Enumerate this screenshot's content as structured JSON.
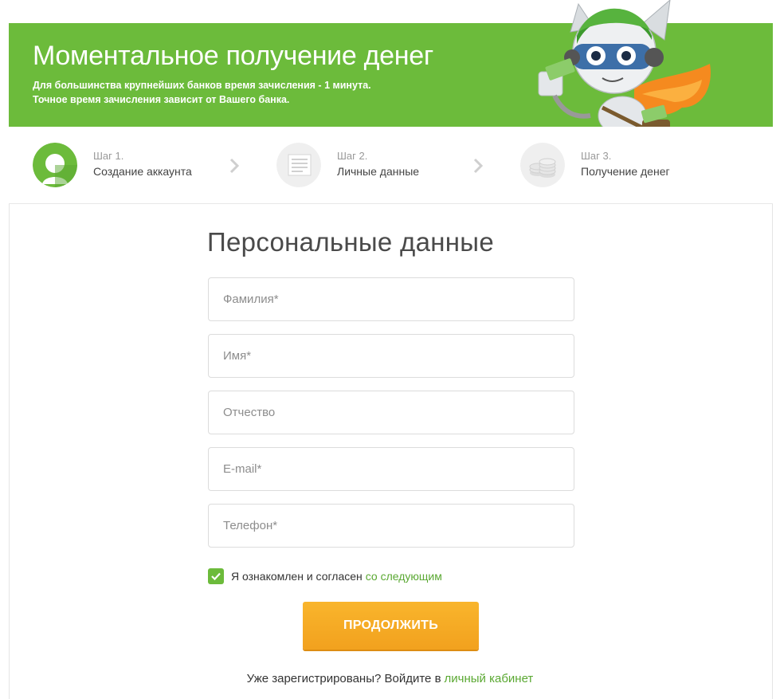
{
  "banner": {
    "title": "Моментальное получение денег",
    "subtitle_line1": "Для большинства крупнейших банков время зачисления - 1 минута.",
    "subtitle_line2": "Точное время зачисления зависит от Вашего банка.",
    "mascot": "robot-mascot",
    "bg_color": "#6cbb3b"
  },
  "steps": [
    {
      "num": "Шаг 1.",
      "label": "Создание аккаунта",
      "icon": "user-icon",
      "active": true
    },
    {
      "num": "Шаг 2.",
      "label": "Личные данные",
      "icon": "document-icon",
      "active": false
    },
    {
      "num": "Шаг 3.",
      "label": "Получение денег",
      "icon": "coins-icon",
      "active": false
    }
  ],
  "form": {
    "title": "Персональные данные",
    "fields": {
      "lastname": {
        "placeholder": "Фамилия*",
        "value": ""
      },
      "firstname": {
        "placeholder": "Имя*",
        "value": ""
      },
      "patronymic": {
        "placeholder": "Отчество",
        "value": ""
      },
      "email": {
        "placeholder": "E-mail*",
        "value": ""
      },
      "phone": {
        "placeholder": "Телефон*",
        "value": ""
      }
    },
    "agree_text": "Я ознакомлен и согласен",
    "agree_link": "со следующим",
    "agree_checked": true,
    "submit_label": "ПРОДОЛЖИТЬ",
    "login_text": "Уже зарегистрированы? Войдите в",
    "login_link": "личный кабинет"
  },
  "colors": {
    "accent": "#6cbb3b",
    "link": "#5aa832",
    "button": "#f5a623"
  }
}
